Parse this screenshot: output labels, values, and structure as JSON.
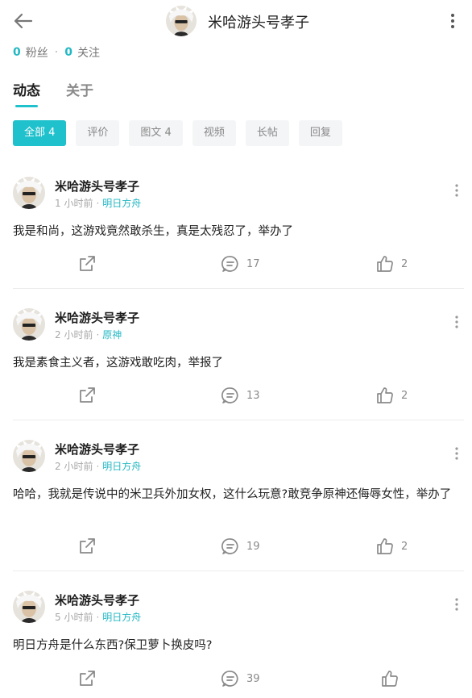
{
  "header": {
    "title": "米哈游头号孝子"
  },
  "stats": {
    "fans_count": "0",
    "fans_label": "粉丝",
    "separator": "·",
    "follow_count": "0",
    "follow_label": "关注"
  },
  "tabs": [
    {
      "label": "动态",
      "active": true
    },
    {
      "label": "关于",
      "active": false
    }
  ],
  "filters": [
    {
      "label": "全部 4",
      "active": true
    },
    {
      "label": "评价",
      "active": false
    },
    {
      "label": "图文 4",
      "active": false
    },
    {
      "label": "视频",
      "active": false
    },
    {
      "label": "长帖",
      "active": false
    },
    {
      "label": "回复",
      "active": false
    }
  ],
  "posts": [
    {
      "author": "米哈游头号孝子",
      "time": "1 小时前",
      "dot": "·",
      "game": "明日方舟",
      "content": "我是和尚，这游戏竟然敢杀生，真是太残忍了，举办了",
      "comments": "17",
      "likes": "2"
    },
    {
      "author": "米哈游头号孝子",
      "time": "2 小时前",
      "dot": "·",
      "game": "原神",
      "content": "我是素食主义者，这游戏敢吃肉，举报了",
      "comments": "13",
      "likes": "2"
    },
    {
      "author": "米哈游头号孝子",
      "time": "2 小时前",
      "dot": "·",
      "game": "明日方舟",
      "content": "哈哈，我就是传说中的米卫兵外加女权，这什么玩意?敢竞争原神还侮辱女性，举办了",
      "comments": "19",
      "likes": "2"
    },
    {
      "author": "米哈游头号孝子",
      "time": "5 小时前",
      "dot": "·",
      "game": "明日方舟",
      "content": "明日方舟是什么东西?保卫萝卜换皮吗?",
      "comments": "39",
      "likes": ""
    }
  ],
  "colors": {
    "accent": "#1fc1cc",
    "link": "#23b8c4",
    "muted": "#a8a8a8",
    "chip_bg": "#f4f5f7"
  },
  "icons": {
    "back": "arrow-left-icon",
    "more": "more-vertical-icon",
    "share": "share-icon",
    "comment": "comment-icon",
    "like": "thumbs-up-icon"
  }
}
